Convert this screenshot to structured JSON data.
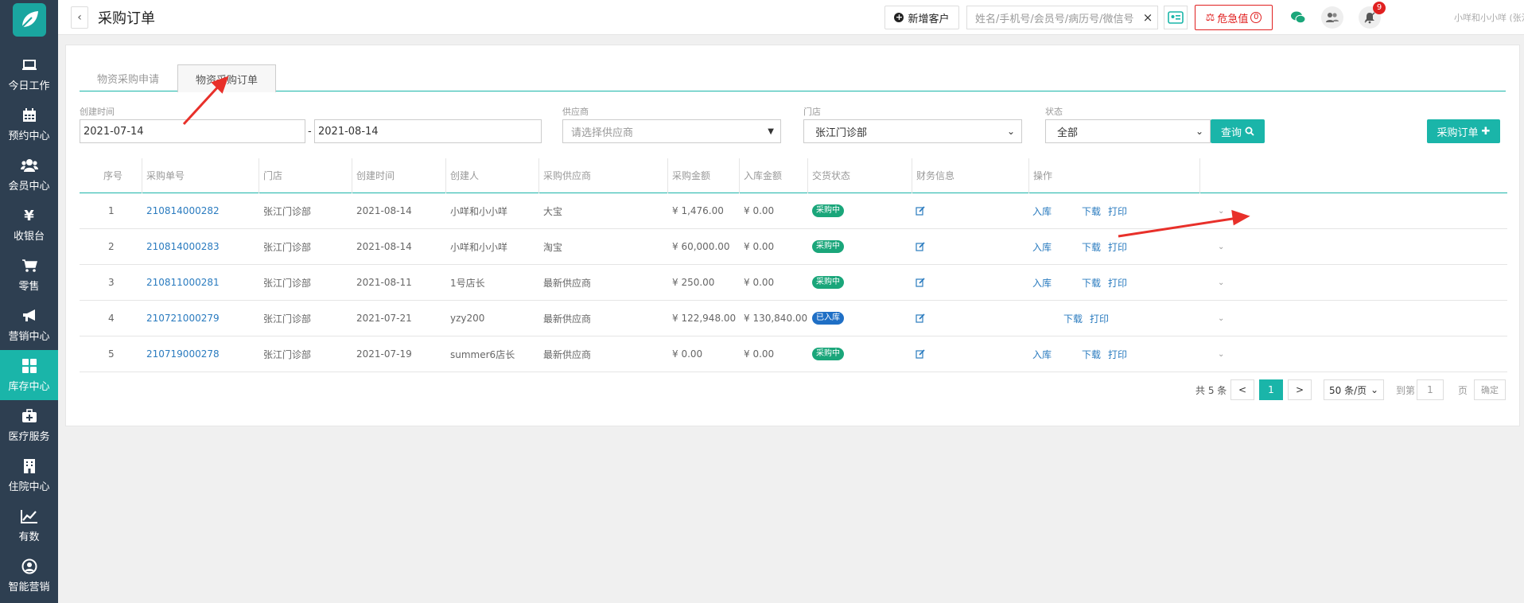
{
  "sidebar": {
    "logo": "leaf-logo",
    "items": [
      {
        "label": "今日工作",
        "icon": "laptop-icon",
        "active": false
      },
      {
        "label": "预约中心",
        "icon": "calendar-icon",
        "active": false
      },
      {
        "label": "会员中心",
        "icon": "users-icon",
        "active": false
      },
      {
        "label": "收银台",
        "icon": "yen-icon",
        "active": false
      },
      {
        "label": "零售",
        "icon": "cart-icon",
        "active": false
      },
      {
        "label": "营销中心",
        "icon": "megaphone-icon",
        "active": false
      },
      {
        "label": "库存中心",
        "icon": "grid-icon",
        "active": true
      },
      {
        "label": "医疗服务",
        "icon": "medkit-icon",
        "active": false
      },
      {
        "label": "住院中心",
        "icon": "building-icon",
        "active": false
      },
      {
        "label": "有数",
        "icon": "line-chart-icon",
        "active": false
      },
      {
        "label": "智能营销",
        "icon": "robot-icon",
        "active": false
      }
    ]
  },
  "header": {
    "back": "‹",
    "title": "采购订单",
    "new_customer": "新增客户",
    "search_placeholder": "姓名/手机号/会员号/病历号/微信号",
    "search_clear": "×",
    "danger_label": "危急值",
    "danger_count": "0",
    "notification_count": "9",
    "user": "小咩和小小咩 (张江门诊部)"
  },
  "tabs": [
    {
      "label": "物资采购申请",
      "active": false
    },
    {
      "label": "物资采购订单",
      "active": true
    }
  ],
  "filters": {
    "created_label": "创建时间",
    "date_from": "2021-07-14",
    "date_sep": "-",
    "date_to": "2021-08-14",
    "supplier_label": "供应商",
    "supplier_placeholder": "请选择供应商",
    "store_label": "门店",
    "store_value": "张江门诊部",
    "status_label": "状态",
    "status_value": "全部",
    "query_button": "查询",
    "new_order_button": "采购订单"
  },
  "table": {
    "columns": [
      "序号",
      "采购单号",
      "门店",
      "创建时间",
      "创建人",
      "采购供应商",
      "采购金额",
      "入库金额",
      "交货状态",
      "财务信息",
      "操作"
    ],
    "rows": [
      {
        "no": "1",
        "order": "210814000282",
        "store": "张江门诊部",
        "date": "2021-08-14",
        "creator": "小咩和小小咩",
        "supplier": "大宝",
        "amount": "¥ 1,476.00",
        "stock_amount": "¥ 0.00",
        "status": "采购中",
        "status_color": "#1aa67a",
        "op_in": "入库",
        "op_dl": "下载",
        "op_pr": "打印"
      },
      {
        "no": "2",
        "order": "210814000283",
        "store": "张江门诊部",
        "date": "2021-08-14",
        "creator": "小咩和小小咩",
        "supplier": "淘宝",
        "amount": "¥ 60,000.00",
        "stock_amount": "¥ 0.00",
        "status": "采购中",
        "status_color": "#1aa67a",
        "op_in": "入库",
        "op_dl": "下载",
        "op_pr": "打印"
      },
      {
        "no": "3",
        "order": "210811000281",
        "store": "张江门诊部",
        "date": "2021-08-11",
        "creator": "1号店长",
        "supplier": "最新供应商",
        "amount": "¥ 250.00",
        "stock_amount": "¥ 0.00",
        "status": "采购中",
        "status_color": "#1aa67a",
        "op_in": "入库",
        "op_dl": "下载",
        "op_pr": "打印"
      },
      {
        "no": "4",
        "order": "210721000279",
        "store": "张江门诊部",
        "date": "2021-07-21",
        "creator": "yzy200",
        "supplier": "最新供应商",
        "amount": "¥ 122,948.00",
        "stock_amount": "¥ 130,840.00",
        "status": "已入库",
        "status_color": "#1f6fc5",
        "op_in": "",
        "op_dl": "下载",
        "op_pr": "打印"
      },
      {
        "no": "5",
        "order": "210719000278",
        "store": "张江门诊部",
        "date": "2021-07-19",
        "creator": "summer6店长",
        "supplier": "最新供应商",
        "amount": "¥ 0.00",
        "stock_amount": "¥ 0.00",
        "status": "采购中",
        "status_color": "#1aa67a",
        "op_in": "入库",
        "op_dl": "下载",
        "op_pr": "打印"
      }
    ]
  },
  "pagination": {
    "total": "共 5 条",
    "prev": "<",
    "current": "1",
    "next": ">",
    "page_size": "50 条/页",
    "goto_label": "到第",
    "goto_value": "1",
    "page_unit": "页",
    "confirm": "确定"
  },
  "colors": {
    "accent": "#1ab5a9",
    "sidebar": "#2e3f51",
    "danger": "#e02020",
    "link": "#2a7bbf"
  }
}
